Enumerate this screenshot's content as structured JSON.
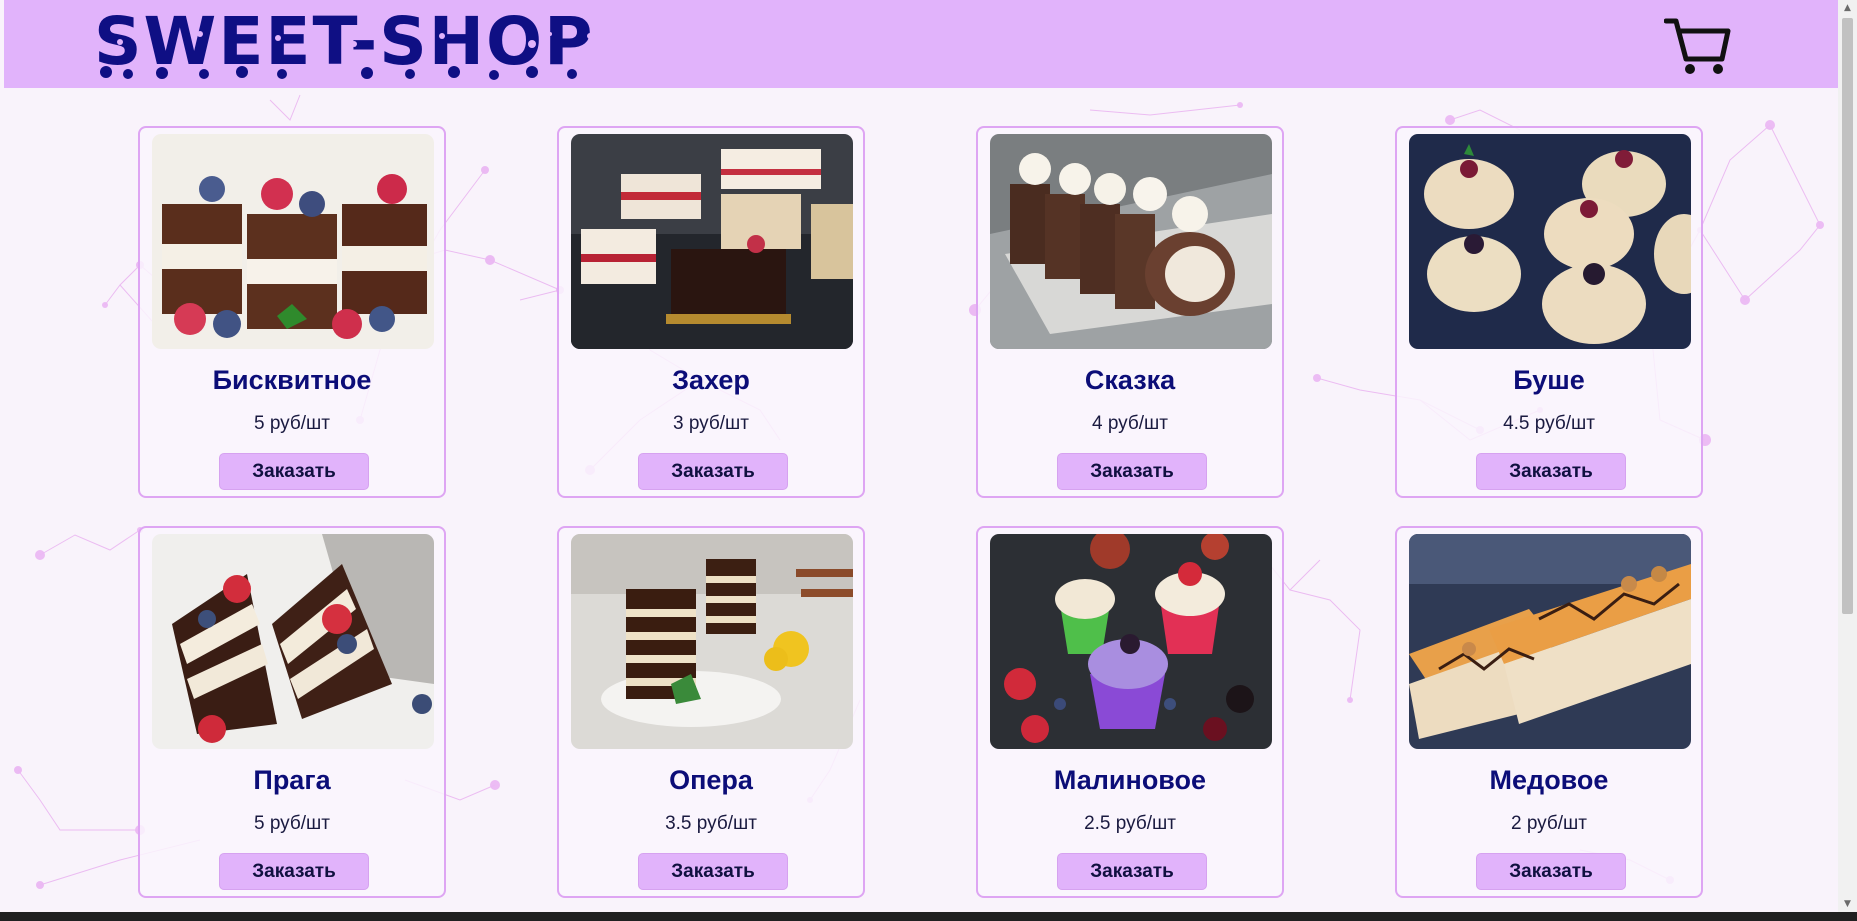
{
  "header": {
    "logo_text": "SWEET-SHOP",
    "cart_icon": "shopping-cart-icon",
    "background_color": "#e1b3fb"
  },
  "theme": {
    "page_bg": "#f9f3fb",
    "card_border": "#dea5f3",
    "title_color": "#0c0d78",
    "button_bg": "#e1b3fb"
  },
  "products": [
    {
      "name": "Бисквитное",
      "price": "5 руб/шт",
      "button": "Заказать",
      "image": "sponge-cake-photo"
    },
    {
      "name": "Захер",
      "price": "3 руб/шт",
      "button": "Заказать",
      "image": "sacher-cake-photo"
    },
    {
      "name": "Сказка",
      "price": "4 руб/шт",
      "button": "Заказать",
      "image": "roll-cake-photo"
    },
    {
      "name": "Буше",
      "price": "4.5 руб/шт",
      "button": "Заказать",
      "image": "bouche-cake-photo"
    },
    {
      "name": "Прага",
      "price": "5 руб/шт",
      "button": "Заказать",
      "image": "prague-cake-photo"
    },
    {
      "name": "Опера",
      "price": "3.5 руб/шт",
      "button": "Заказать",
      "image": "opera-cake-photo"
    },
    {
      "name": "Малиновое",
      "price": "2.5 руб/шт",
      "button": "Заказать",
      "image": "raspberry-cupcakes-photo"
    },
    {
      "name": "Медовое",
      "price": "2 руб/шт",
      "button": "Заказать",
      "image": "honey-cake-photo"
    }
  ]
}
